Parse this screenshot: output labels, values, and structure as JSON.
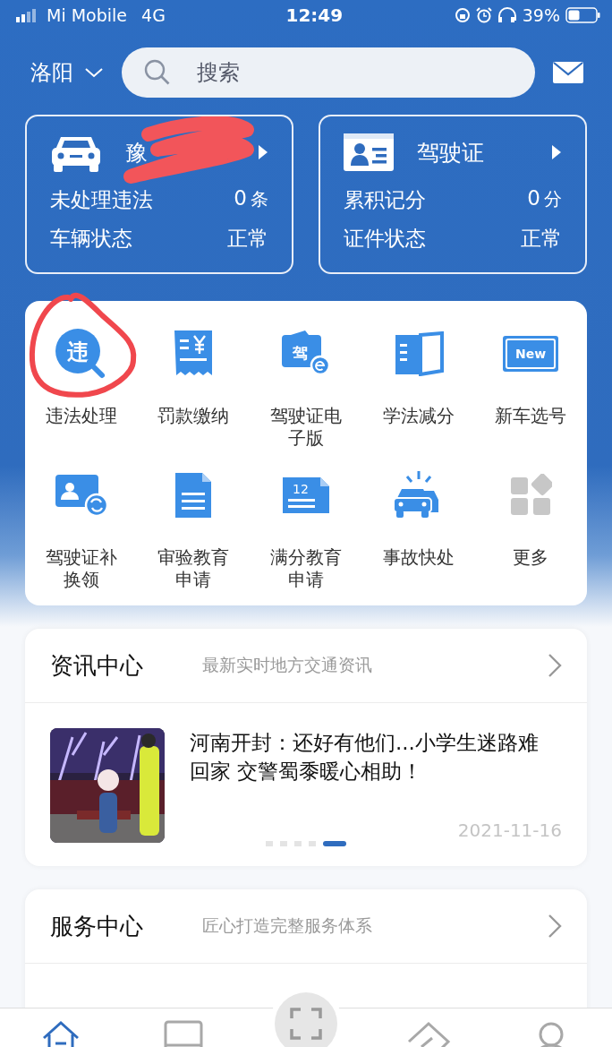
{
  "status_bar": {
    "carrier": "Mi Mobile",
    "network": "4G",
    "time": "12:49",
    "battery": "39%"
  },
  "header": {
    "city": "洛阳",
    "search": {
      "placeholder": "搜索"
    }
  },
  "summary_cards": [
    {
      "kind": "vehicle",
      "title": "豫",
      "redacted": true,
      "rows": [
        {
          "label": "未处理违法",
          "value": "0",
          "unit": "条"
        },
        {
          "label": "车辆状态",
          "value": "正常"
        }
      ]
    },
    {
      "kind": "license",
      "title": "驾驶证",
      "redacted": false,
      "rows": [
        {
          "label": "累积记分",
          "value": "0",
          "unit": "分"
        },
        {
          "label": "证件状态",
          "value": "正常"
        }
      ]
    }
  ],
  "shortcuts": [
    {
      "kind": "violation",
      "icon_text": "违",
      "label": "违法处理",
      "circled": true
    },
    {
      "kind": "fine",
      "label": "罚款缴纳",
      "circled": false
    },
    {
      "kind": "elicense",
      "icon_text": "驾",
      "label": "驾驶证电子版",
      "circled": false
    },
    {
      "kind": "study",
      "label": "学法减分",
      "circled": false
    },
    {
      "kind": "newcar",
      "icon_text": "New",
      "label": "新车选号",
      "circled": false
    },
    {
      "kind": "renew",
      "label": "驾驶证补换领",
      "circled": false
    },
    {
      "kind": "document",
      "label": "审验教育申请",
      "circled": false
    },
    {
      "kind": "points",
      "icon_text": "12",
      "label": "满分教育申请",
      "circled": false
    },
    {
      "kind": "accident",
      "label": "事故快处",
      "circled": false
    },
    {
      "kind": "more",
      "label": "更多",
      "circled": false
    }
  ],
  "news": {
    "title": "资讯中心",
    "subtitle": "最新实时地方交通资讯",
    "article": {
      "headline": "河南开封：还好有他们...小学生迷路难回家 交警蜀黍暖心相助！",
      "date": "2021-11-16"
    },
    "pager": [
      {
        "selected": false
      },
      {
        "selected": false
      },
      {
        "selected": false
      },
      {
        "selected": false
      },
      {
        "selected": true
      }
    ]
  },
  "services": {
    "title": "服务中心",
    "subtitle": "匠心打造完整服务体系"
  },
  "tab_bar": [
    {
      "kind": "home",
      "selected": true
    },
    {
      "kind": "book",
      "selected": false
    },
    {
      "kind": "scan",
      "selected": false
    },
    {
      "kind": "tag",
      "selected": false
    },
    {
      "kind": "user",
      "selected": false
    }
  ]
}
